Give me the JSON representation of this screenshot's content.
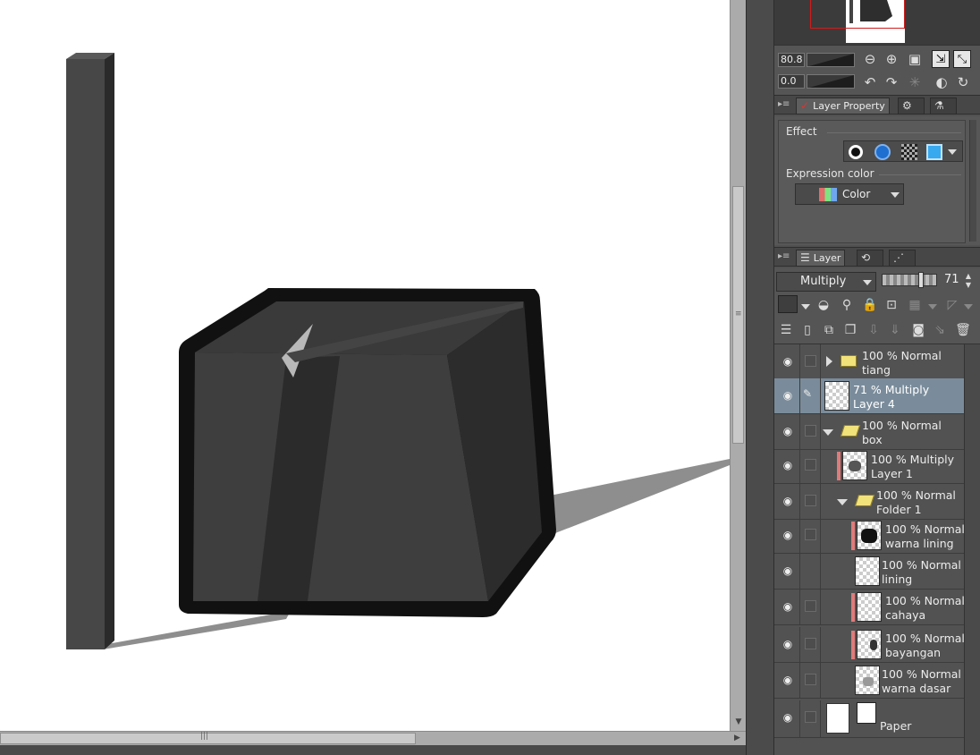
{
  "navigator": {
    "zoom_value": "80.8",
    "rotate_value": "0.0"
  },
  "property_panel": {
    "tab_label": "Layer Property",
    "effect_label": "Effect",
    "expression_label": "Expression color",
    "expression_value": "Color"
  },
  "layer_panel": {
    "tab_label": "Layer",
    "blend_mode": "Multiply",
    "opacity": "71",
    "layers": [
      {
        "line1": "100 % Normal",
        "line2": "tiang"
      },
      {
        "line1": "71 % Multiply",
        "line2": "Layer 4"
      },
      {
        "line1": "100 % Normal",
        "line2": "box"
      },
      {
        "line1": "100 % Multiply",
        "line2": "Layer 1"
      },
      {
        "line1": "100 % Normal",
        "line2": "Folder 1"
      },
      {
        "line1": "100 % Normal",
        "line2": "warna lining"
      },
      {
        "line1": "100 % Normal",
        "line2": "lining"
      },
      {
        "line1": "100 % Normal",
        "line2": "cahaya"
      },
      {
        "line1": "100 % Normal",
        "line2": "bayangan"
      },
      {
        "line1": "100 % Normal",
        "line2": "warna dasar"
      },
      {
        "line1": "",
        "line2": "Paper"
      }
    ]
  },
  "colors": {
    "selection": "#7a8c9b",
    "mask_mark": "#e07b7b",
    "nav_frame": "#d21b1b"
  }
}
